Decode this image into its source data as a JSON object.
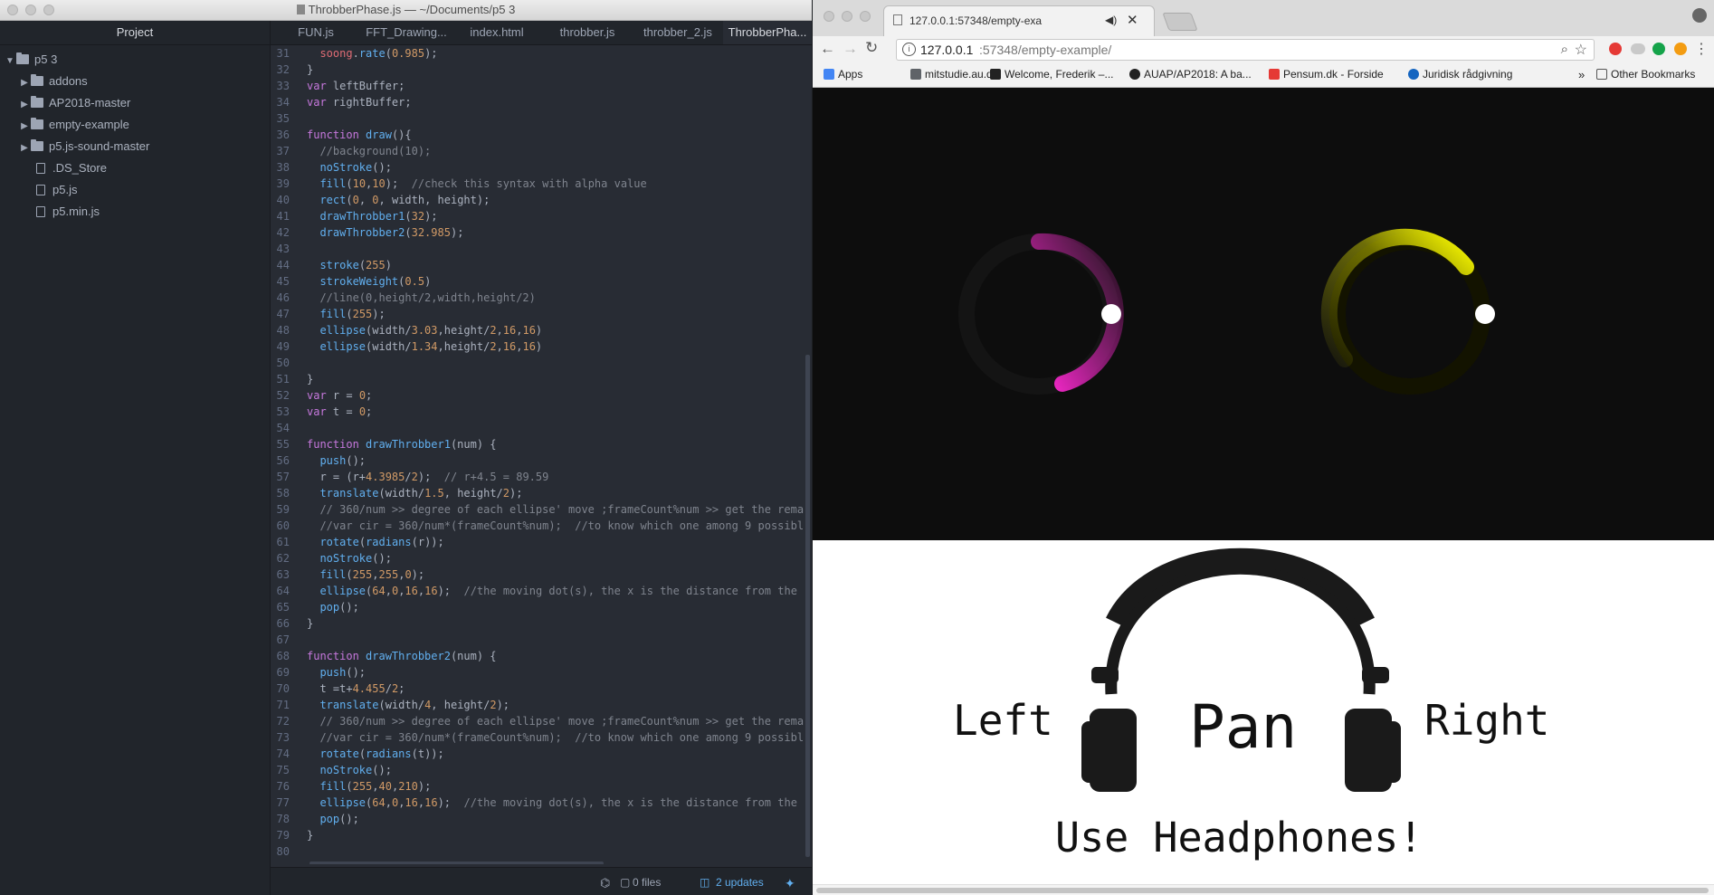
{
  "editor": {
    "window_title": "ThrobberPhase.js — ~/Documents/p5 3",
    "tree": {
      "header": "Project",
      "root": "p5 3",
      "folders": [
        "addons",
        "AP2018-master",
        "empty-example",
        "p5.js-sound-master"
      ],
      "files": [
        ".DS_Store",
        "p5.js",
        "p5.min.js"
      ]
    },
    "tabs": [
      "FUN.js",
      "FFT_Drawing...",
      "index.html",
      "throbber.js",
      "throbber_2.js",
      "ThrobberPha..."
    ],
    "code_lines": [
      {
        "n": "31",
        "html": "  <span style=\"color:#e06c75\">soong</span>.<span style=\"color:#61afef\">rate</span>(<span style=\"color:#d19a66\">0.985</span>);"
      },
      {
        "n": "32",
        "html": "}"
      },
      {
        "n": "33",
        "html": "<span style=\"color:#c678dd\">var</span> leftBuffer;"
      },
      {
        "n": "34",
        "html": "<span style=\"color:#c678dd\">var</span> rightBuffer;"
      },
      {
        "n": "35",
        "html": ""
      },
      {
        "n": "36",
        "html": "<span style=\"color:#c678dd\">function</span> <span style=\"color:#61afef\">draw</span>(){"
      },
      {
        "n": "37",
        "html": "  <span style=\"color:#7f848e\">//background(10);</span>"
      },
      {
        "n": "38",
        "html": "  <span style=\"color:#61afef\">noStroke</span>();"
      },
      {
        "n": "39",
        "html": "  <span style=\"color:#61afef\">fill</span>(<span style=\"color:#d19a66\">10</span>,<span style=\"color:#d19a66\">10</span>);  <span style=\"color:#7f848e\">//check this syntax with alpha value</span>"
      },
      {
        "n": "40",
        "html": "  <span style=\"color:#61afef\">rect</span>(<span style=\"color:#d19a66\">0</span>, <span style=\"color:#d19a66\">0</span>, width, height);"
      },
      {
        "n": "41",
        "html": "  <span style=\"color:#61afef\">drawThrobber1</span>(<span style=\"color:#d19a66\">32</span>);"
      },
      {
        "n": "42",
        "html": "  <span style=\"color:#61afef\">drawThrobber2</span>(<span style=\"color:#d19a66\">32.985</span>);"
      },
      {
        "n": "43",
        "html": ""
      },
      {
        "n": "44",
        "html": "  <span style=\"color:#61afef\">stroke</span>(<span style=\"color:#d19a66\">255</span>)"
      },
      {
        "n": "45",
        "html": "  <span style=\"color:#61afef\">strokeWeight</span>(<span style=\"color:#d19a66\">0.5</span>)"
      },
      {
        "n": "46",
        "html": "  <span style=\"color:#7f848e\">//line(0,height/2,width,height/2)</span>"
      },
      {
        "n": "47",
        "html": "  <span style=\"color:#61afef\">fill</span>(<span style=\"color:#d19a66\">255</span>);"
      },
      {
        "n": "48",
        "html": "  <span style=\"color:#61afef\">ellipse</span>(width/<span style=\"color:#d19a66\">3.03</span>,height/<span style=\"color:#d19a66\">2</span>,<span style=\"color:#d19a66\">16</span>,<span style=\"color:#d19a66\">16</span>)"
      },
      {
        "n": "49",
        "html": "  <span style=\"color:#61afef\">ellipse</span>(width/<span style=\"color:#d19a66\">1.34</span>,height/<span style=\"color:#d19a66\">2</span>,<span style=\"color:#d19a66\">16</span>,<span style=\"color:#d19a66\">16</span>)"
      },
      {
        "n": "50",
        "html": ""
      },
      {
        "n": "51",
        "html": "}"
      },
      {
        "n": "52",
        "html": "<span style=\"color:#c678dd\">var</span> r = <span style=\"color:#d19a66\">0</span>;"
      },
      {
        "n": "53",
        "html": "<span style=\"color:#c678dd\">var</span> t = <span style=\"color:#d19a66\">0</span>;"
      },
      {
        "n": "54",
        "html": ""
      },
      {
        "n": "55",
        "html": "<span style=\"color:#c678dd\">function</span> <span style=\"color:#61afef\">drawThrobber1</span>(num) {"
      },
      {
        "n": "56",
        "html": "  <span style=\"color:#61afef\">push</span>();"
      },
      {
        "n": "57",
        "html": "  r = (r+<span style=\"color:#d19a66\">4.3985</span>/<span style=\"color:#d19a66\">2</span>);  <span style=\"color:#7f848e\">// r+4.5 = 89.59</span>"
      },
      {
        "n": "58",
        "html": "  <span style=\"color:#61afef\">translate</span>(width/<span style=\"color:#d19a66\">1.5</span>, height/<span style=\"color:#d19a66\">2</span>);"
      },
      {
        "n": "59",
        "html": "  <span style=\"color:#7f848e\">// 360/num >> degree of each ellipse' move ;frameCount%num >> get the rema</span>"
      },
      {
        "n": "60",
        "html": "  <span style=\"color:#7f848e\">//var cir = 360/num*(frameCount%num);  //to know which one among 9 possibl</span>"
      },
      {
        "n": "61",
        "html": "  <span style=\"color:#61afef\">rotate</span>(<span style=\"color:#61afef\">radians</span>(r));"
      },
      {
        "n": "62",
        "html": "  <span style=\"color:#61afef\">noStroke</span>();"
      },
      {
        "n": "63",
        "html": "  <span style=\"color:#61afef\">fill</span>(<span style=\"color:#d19a66\">255</span>,<span style=\"color:#d19a66\">255</span>,<span style=\"color:#d19a66\">0</span>);"
      },
      {
        "n": "64",
        "html": "  <span style=\"color:#61afef\">ellipse</span>(<span style=\"color:#d19a66\">64</span>,<span style=\"color:#d19a66\">0</span>,<span style=\"color:#d19a66\">16</span>,<span style=\"color:#d19a66\">16</span>);  <span style=\"color:#7f848e\">//the moving dot(s), the x is the distance from the</span>"
      },
      {
        "n": "65",
        "html": "  <span style=\"color:#61afef\">pop</span>();"
      },
      {
        "n": "66",
        "html": "}"
      },
      {
        "n": "67",
        "html": ""
      },
      {
        "n": "68",
        "html": "<span style=\"color:#c678dd\">function</span> <span style=\"color:#61afef\">drawThrobber2</span>(num) {"
      },
      {
        "n": "69",
        "html": "  <span style=\"color:#61afef\">push</span>();"
      },
      {
        "n": "70",
        "html": "  t =t+<span style=\"color:#d19a66\">4.455</span>/<span style=\"color:#d19a66\">2</span>;"
      },
      {
        "n": "71",
        "html": "  <span style=\"color:#61afef\">translate</span>(width/<span style=\"color:#d19a66\">4</span>, height/<span style=\"color:#d19a66\">2</span>);"
      },
      {
        "n": "72",
        "html": "  <span style=\"color:#7f848e\">// 360/num >> degree of each ellipse' move ;frameCount%num >> get the rema</span>"
      },
      {
        "n": "73",
        "html": "  <span style=\"color:#7f848e\">//var cir = 360/num*(frameCount%num);  //to know which one among 9 possibl</span>"
      },
      {
        "n": "74",
        "html": "  <span style=\"color:#61afef\">rotate</span>(<span style=\"color:#61afef\">radians</span>(t));"
      },
      {
        "n": "75",
        "html": "  <span style=\"color:#61afef\">noStroke</span>();"
      },
      {
        "n": "76",
        "html": "  <span style=\"color:#61afef\">fill</span>(<span style=\"color:#d19a66\">255</span>,<span style=\"color:#d19a66\">40</span>,<span style=\"color:#d19a66\">210</span>);"
      },
      {
        "n": "77",
        "html": "  <span style=\"color:#61afef\">ellipse</span>(<span style=\"color:#d19a66\">64</span>,<span style=\"color:#d19a66\">0</span>,<span style=\"color:#d19a66\">16</span>,<span style=\"color:#d19a66\">16</span>);  <span style=\"color:#7f848e\">//the moving dot(s), the x is the distance from the</span>"
      },
      {
        "n": "78",
        "html": "  <span style=\"color:#61afef\">pop</span>();"
      },
      {
        "n": "79",
        "html": "}"
      },
      {
        "n": "80",
        "html": ""
      }
    ],
    "status": {
      "files": "0 files",
      "updates": "2 updates"
    }
  },
  "browser": {
    "tab_title": "127.0.0.1:57348/empty-exa",
    "url_host": "127.0.0.1",
    "url_rest": ":57348/empty-example/",
    "bookmarks": [
      {
        "label": "Apps",
        "color": "#4285f4"
      },
      {
        "label": "mitstudie.au.dk",
        "color": "#5f6368"
      },
      {
        "label": "Welcome, Frederik –...",
        "color": "#222222"
      },
      {
        "label": "AUAP/AP2018: A ba...",
        "color": "#222222"
      },
      {
        "label": "Pensum.dk - Forside",
        "color": "#e53935"
      },
      {
        "label": "Juridisk rådgivning",
        "color": "#1565c0"
      }
    ],
    "other_bookmarks": "Other Bookmarks",
    "canvas": {
      "left_throbber_color": "#ff28d2",
      "right_throbber_color": "#ffff00",
      "left_label": "Left",
      "center_label": "Pan",
      "right_label": "Right",
      "headline": "Use Headphones!"
    }
  }
}
